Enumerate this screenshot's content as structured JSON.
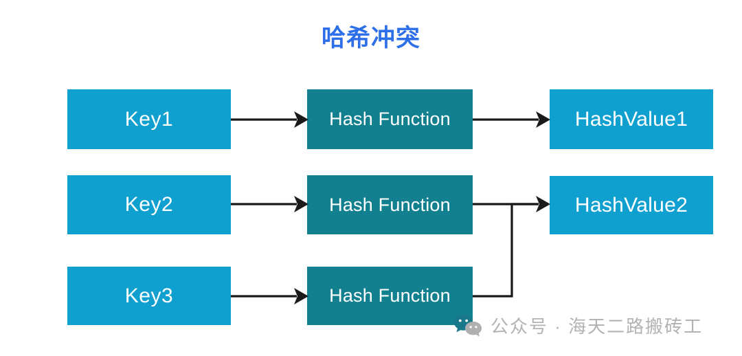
{
  "title": "哈希冲突",
  "colors": {
    "title": "#2d6fe8",
    "key_box": "#0fa0d0",
    "function_box": "#13808f",
    "value_box": "#0fa0d0",
    "arrow": "#1a1a1a",
    "watermark_text": "#b3b3b3",
    "background": "#ffffff"
  },
  "diagram": {
    "rows": [
      {
        "key": "Key1",
        "func": "Hash Function",
        "value": "HashValue1"
      },
      {
        "key": "Key2",
        "func": "Hash Function",
        "value": "HashValue2"
      },
      {
        "key": "Key3",
        "func": "Hash Function",
        "value": ""
      }
    ],
    "columns": [
      "Key",
      "Hash Function",
      "HashValue"
    ]
  },
  "watermark": {
    "icon": "wechat-icon",
    "text": "公众号 · 海天二路搬砖工"
  }
}
